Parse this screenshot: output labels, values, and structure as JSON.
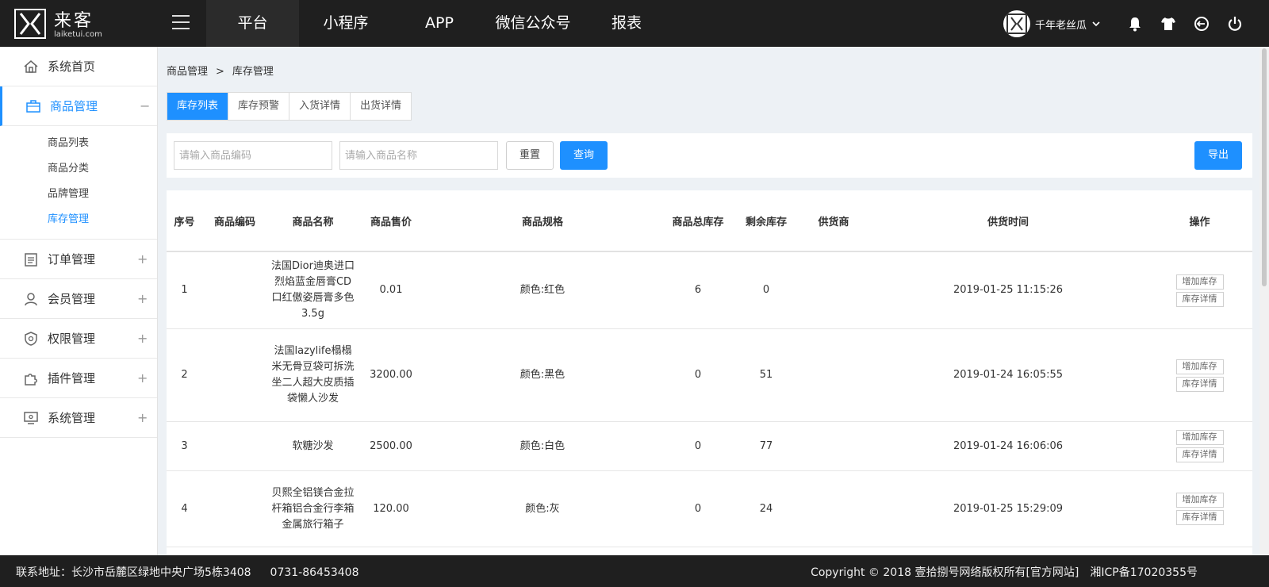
{
  "brand": {
    "title": "来客",
    "subtitle": "laiketui.com"
  },
  "topnav": [
    "平台",
    "小程序",
    "APP",
    "微信公众号",
    "报表"
  ],
  "user": {
    "name": "千年老丝瓜"
  },
  "sidebar": {
    "items": [
      {
        "label": "系统首页",
        "toggle": ""
      },
      {
        "label": "商品管理",
        "toggle": "−"
      },
      {
        "label": "订单管理",
        "toggle": "+"
      },
      {
        "label": "会员管理",
        "toggle": "+"
      },
      {
        "label": "权限管理",
        "toggle": "+"
      },
      {
        "label": "插件管理",
        "toggle": "+"
      },
      {
        "label": "系统管理",
        "toggle": "+"
      }
    ],
    "submenu": [
      "商品列表",
      "商品分类",
      "品牌管理",
      "库存管理"
    ]
  },
  "breadcrumb": {
    "parent": "商品管理",
    "sep": ">",
    "current": "库存管理"
  },
  "tabs": [
    "库存列表",
    "库存预警",
    "入货详情",
    "出货详情"
  ],
  "filter": {
    "code_placeholder": "请输入商品编码",
    "name_placeholder": "请输入商品名称",
    "reset_label": "重置",
    "query_label": "查询",
    "export_label": "导出"
  },
  "table": {
    "headers": [
      "序号",
      "商品编码",
      "商品名称",
      "商品售价",
      "商品规格",
      "商品总库存",
      "剩余库存",
      "供货商",
      "供货时间",
      "操作"
    ],
    "rows": [
      {
        "no": "1",
        "code": "",
        "name": "法国Dior迪奥进口烈焰蓝金唇膏CD口红傲姿唇膏多色 3.5g",
        "price": "0.01",
        "spec": "颜色:红色",
        "total": "6",
        "remain": "0",
        "supplier": "",
        "time": "2019-01-25 11:15:26"
      },
      {
        "no": "2",
        "code": "",
        "name": "法国lazylife榻榻米无骨豆袋可拆洗坐二人超大皮质插袋懒人沙发",
        "price": "3200.00",
        "spec": "颜色:黑色",
        "total": "0",
        "remain": "51",
        "supplier": "",
        "time": "2019-01-24 16:05:55"
      },
      {
        "no": "3",
        "code": "",
        "name": "软糖沙发",
        "price": "2500.00",
        "spec": "颜色:白色",
        "total": "0",
        "remain": "77",
        "supplier": "",
        "time": "2019-01-24 16:06:06"
      },
      {
        "no": "4",
        "code": "",
        "name": "贝熙全铝镁合金拉杆箱铝合金行李箱金属旅行箱子",
        "price": "120.00",
        "spec": "颜色:灰",
        "total": "0",
        "remain": "24",
        "supplier": "",
        "time": "2019-01-25 15:29:09"
      }
    ],
    "op_add": "增加库存",
    "op_detail": "库存详情"
  },
  "footer": {
    "address": "联系地址：长沙市岳麓区绿地中央广场5栋3408",
    "phone": "0731-86453408",
    "copyright": "Copyright © 2018 壹拾捌号网络版权所有[官方网站]",
    "icp": "湘ICP备17020355号"
  }
}
